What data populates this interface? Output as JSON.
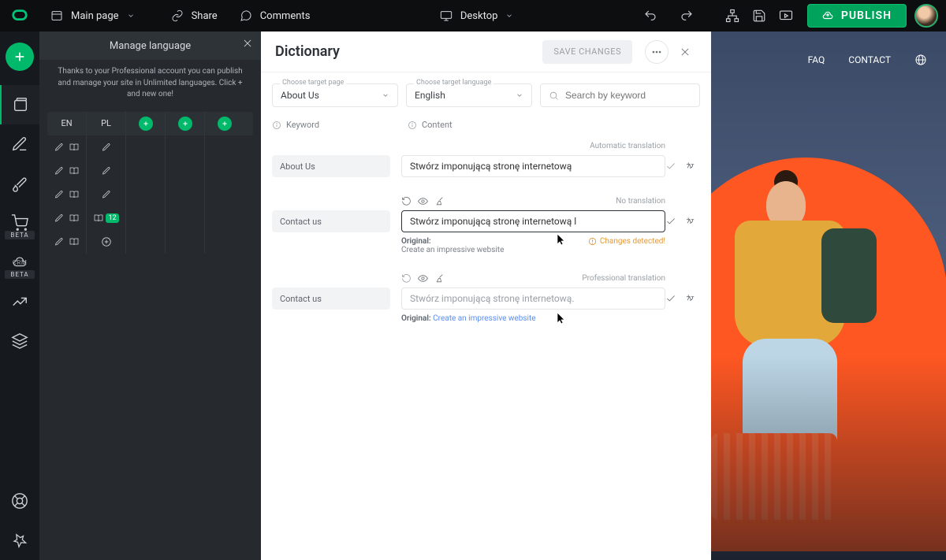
{
  "topbar": {
    "page_label": "Main page",
    "share_label": "Share",
    "comments_label": "Comments",
    "device_label": "Desktop",
    "publish_label": "PUBLISH"
  },
  "rail": {
    "beta_badge": "BETA",
    "crm_label": "CRM"
  },
  "lang_panel": {
    "title": "Manage language",
    "notice": "Thanks to your Professional account you can publish and manage your site in Unlimited languages. Click + and new one!",
    "col_en": "EN",
    "col_pl": "PL",
    "count_badge": "12"
  },
  "dict": {
    "title": "Dictionary",
    "save_label": "SAVE CHANGES",
    "page_field_label": "Choose target page",
    "page_value": "About Us",
    "lang_field_label": "Choose target language",
    "lang_value": "English",
    "search_placeholder": "Search by keyword",
    "keyword_label": "Keyword",
    "content_label": "Content",
    "rows": [
      {
        "keyword": "About Us",
        "status": "Automatic translation",
        "value": "Stwórz imponującą stronę internetową",
        "bordered": false,
        "below_original": "",
        "below_text": "",
        "below_link": "",
        "changes": ""
      },
      {
        "keyword": "Contact us",
        "status": "No translation",
        "value": "Stwórz imponującą stronę internetową l",
        "bordered": true,
        "below_original": "Original:",
        "below_text": "Create an impressive website",
        "below_link": "",
        "changes": "Changes detected!"
      },
      {
        "keyword": "Contact us",
        "status": "Professional translation",
        "value": "Stwórz imponującą stronę internetową.",
        "bordered": false,
        "below_original": "Original:",
        "below_text": "",
        "below_link": "Create an impressive website",
        "changes": ""
      }
    ]
  },
  "site": {
    "nav_faq": "FAQ",
    "nav_contact": "CONTACT"
  }
}
